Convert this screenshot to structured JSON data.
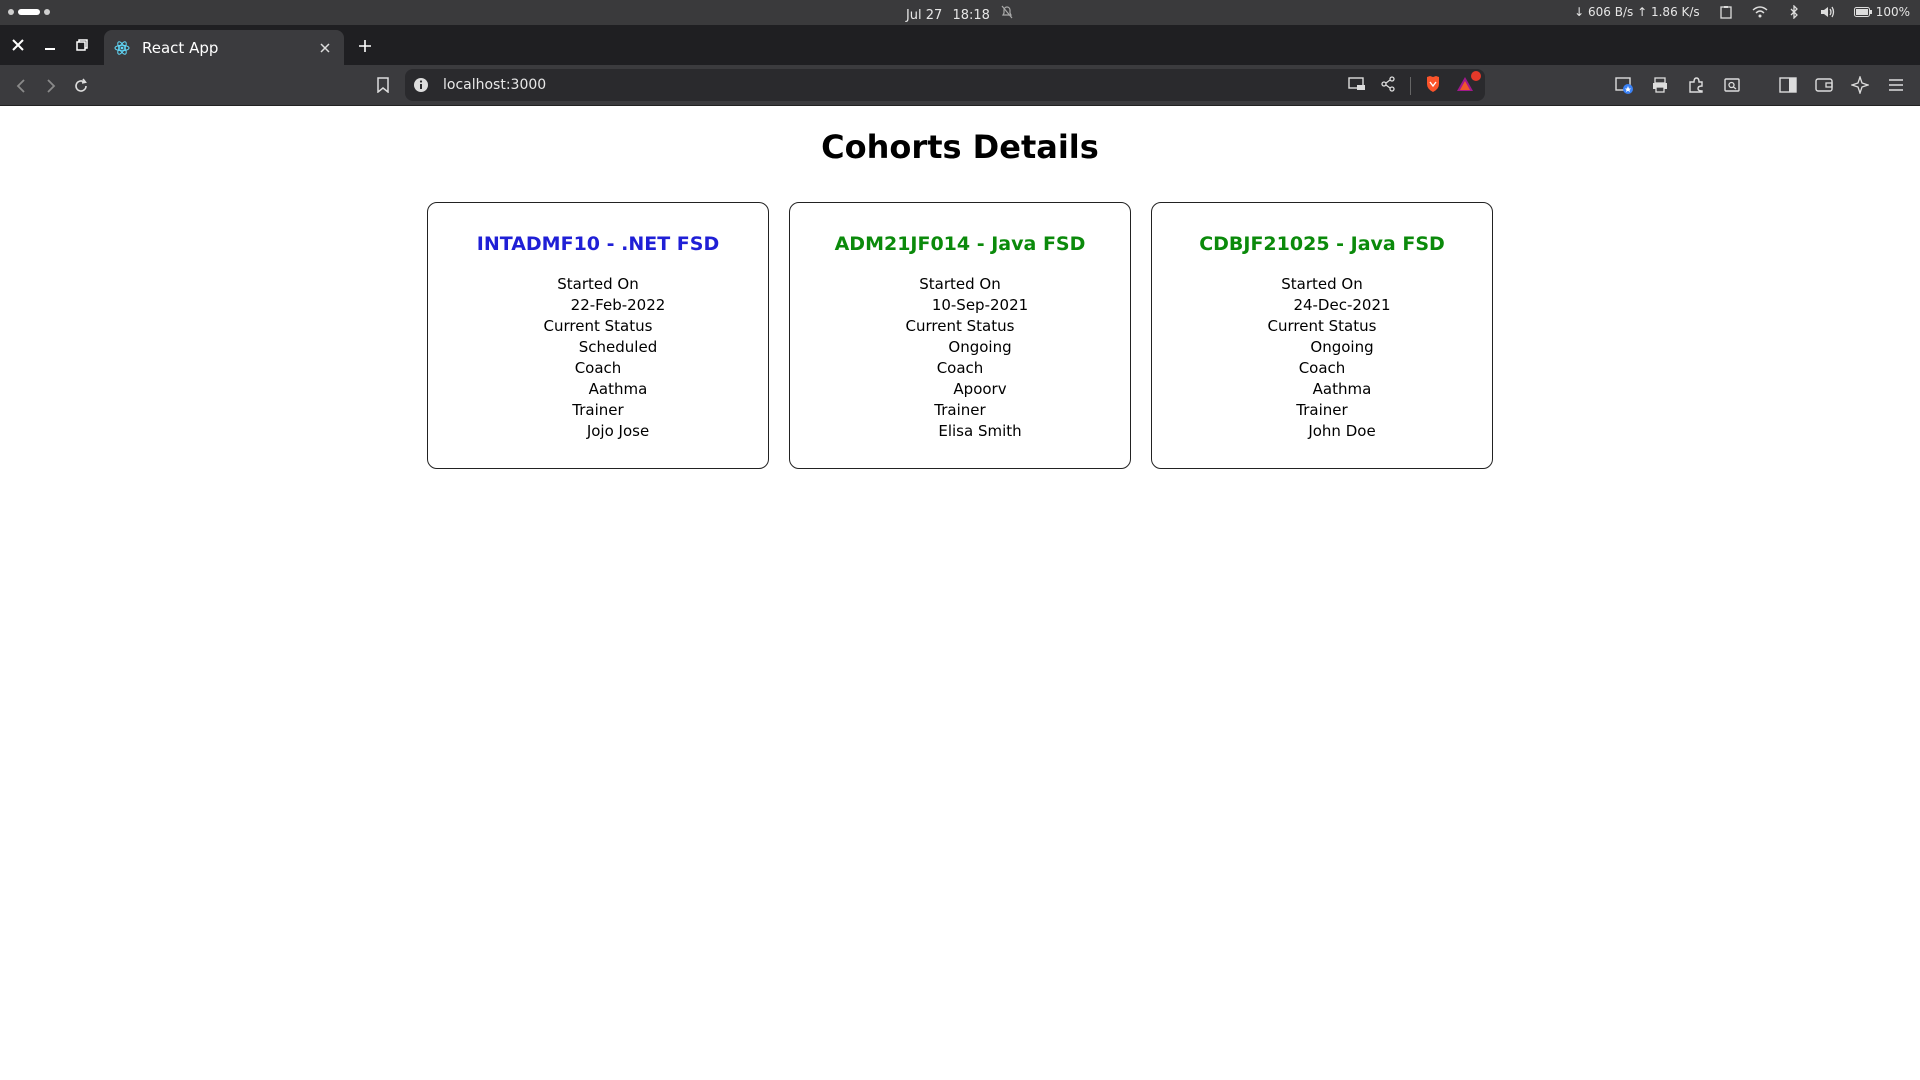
{
  "os": {
    "date": "Jul 27",
    "time": "18:18",
    "net_down": "↓ 606 B/s",
    "net_up": "↑ 1.86 K/s",
    "battery": "100%"
  },
  "browser": {
    "tab_title": "React App",
    "url": "localhost:3000"
  },
  "page": {
    "title": "Cohorts Details",
    "labels": {
      "started_on": "Started On",
      "status": "Current Status",
      "coach": "Coach",
      "trainer": "Trainer"
    },
    "cohorts": [
      {
        "name": "INTADMF10 - .NET FSD",
        "title_color": "#1f1fd6",
        "started_on": "22-Feb-2022",
        "status": "Scheduled",
        "coach": "Aathma",
        "trainer": "Jojo Jose"
      },
      {
        "name": "ADM21JF014 - Java FSD",
        "title_color": "#0b8a0b",
        "started_on": "10-Sep-2021",
        "status": "Ongoing",
        "coach": "Apoorv",
        "trainer": "Elisa Smith"
      },
      {
        "name": "CDBJF21025 - Java FSD",
        "title_color": "#0b8a0b",
        "started_on": "24-Dec-2021",
        "status": "Ongoing",
        "coach": "Aathma",
        "trainer": "John Doe"
      }
    ]
  }
}
